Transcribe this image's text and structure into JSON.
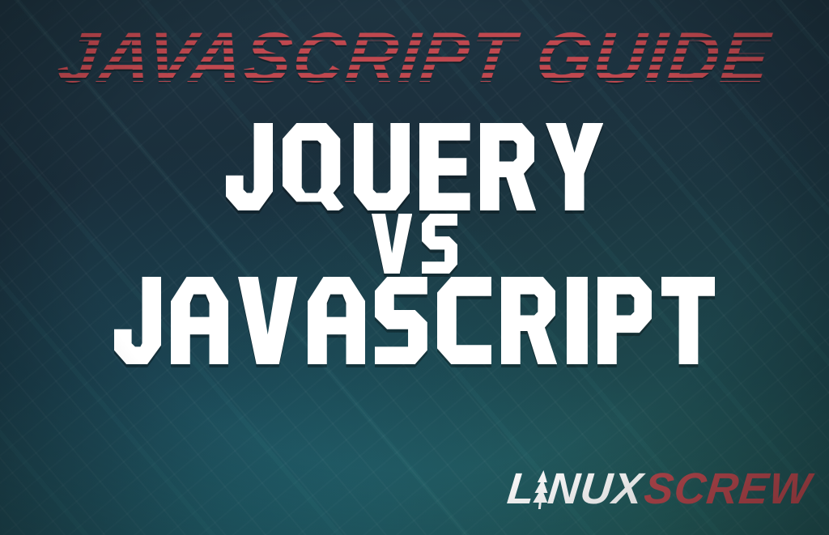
{
  "kicker": "JAVASCRIPT GUIDE",
  "headline": {
    "line1": "JQUERY",
    "line2": "VS",
    "line3": "JAVASCRIPT"
  },
  "logo": {
    "part1": "L",
    "part2": "NUX",
    "part3": "SCREW",
    "icon_name": "pine-tree-icon"
  },
  "colors": {
    "kicker": "#c0484f",
    "headline": "#ffffff",
    "logo_primary": "#ffffff",
    "logo_accent": "#b4474d",
    "background_base": "#1a2e3b"
  }
}
